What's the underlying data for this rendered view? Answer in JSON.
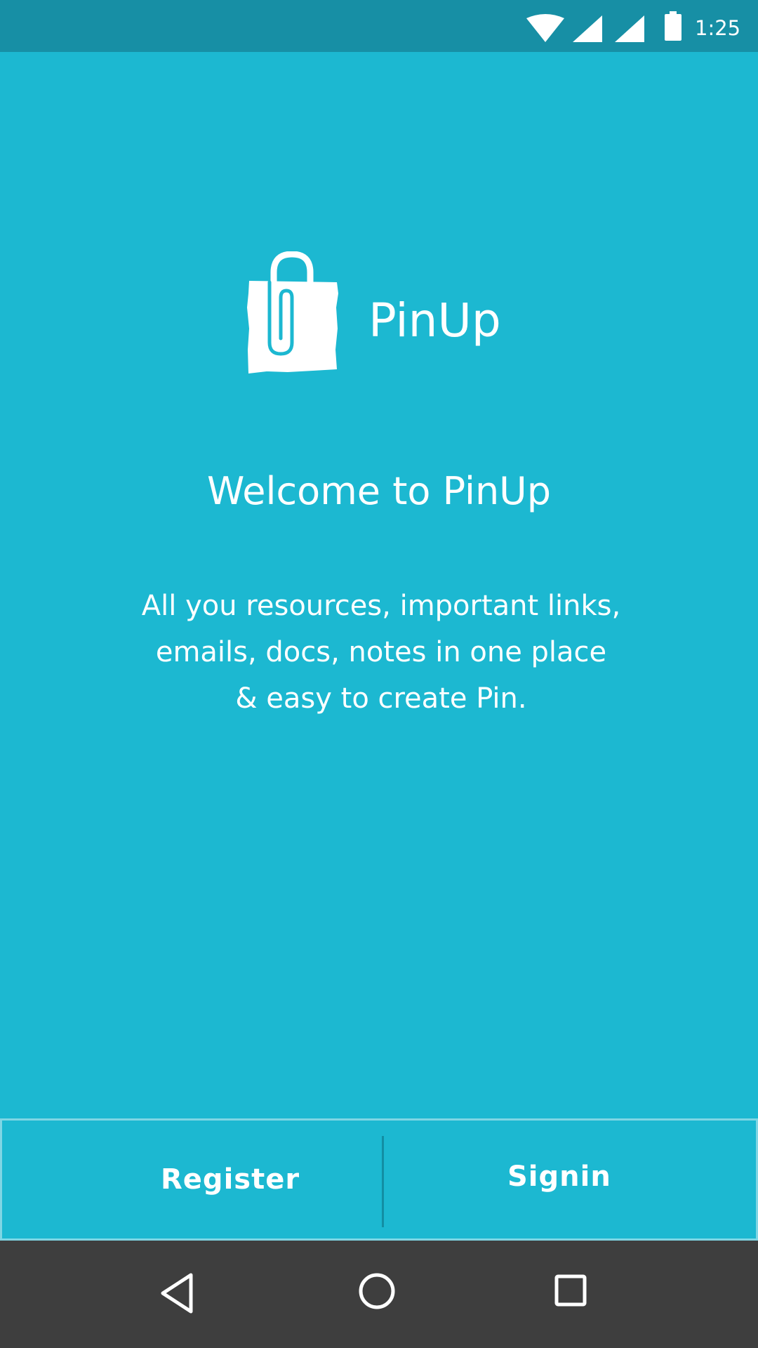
{
  "status_bar": {
    "time": "1:25",
    "icons": [
      "wifi-icon",
      "cell-signal-icon",
      "cell-signal-icon",
      "battery-icon"
    ]
  },
  "logo": {
    "icon": "shopping-bag-paperclip-icon",
    "name": "PinUp"
  },
  "welcome": {
    "title": "Welcome to PinUp",
    "description_lines": [
      "All you resources, important links,",
      "emails, docs, notes in one place",
      "& easy to create Pin."
    ]
  },
  "actions": {
    "register_label": "Register",
    "signin_label": "Signin"
  },
  "nav_bar": {
    "icons": [
      "back-icon",
      "home-icon",
      "recents-icon"
    ]
  },
  "colors": {
    "background": "#1CB8D1",
    "status_bar": "#178FA5",
    "nav_bar": "#3E3E3E",
    "text": "#FFFFFF"
  }
}
